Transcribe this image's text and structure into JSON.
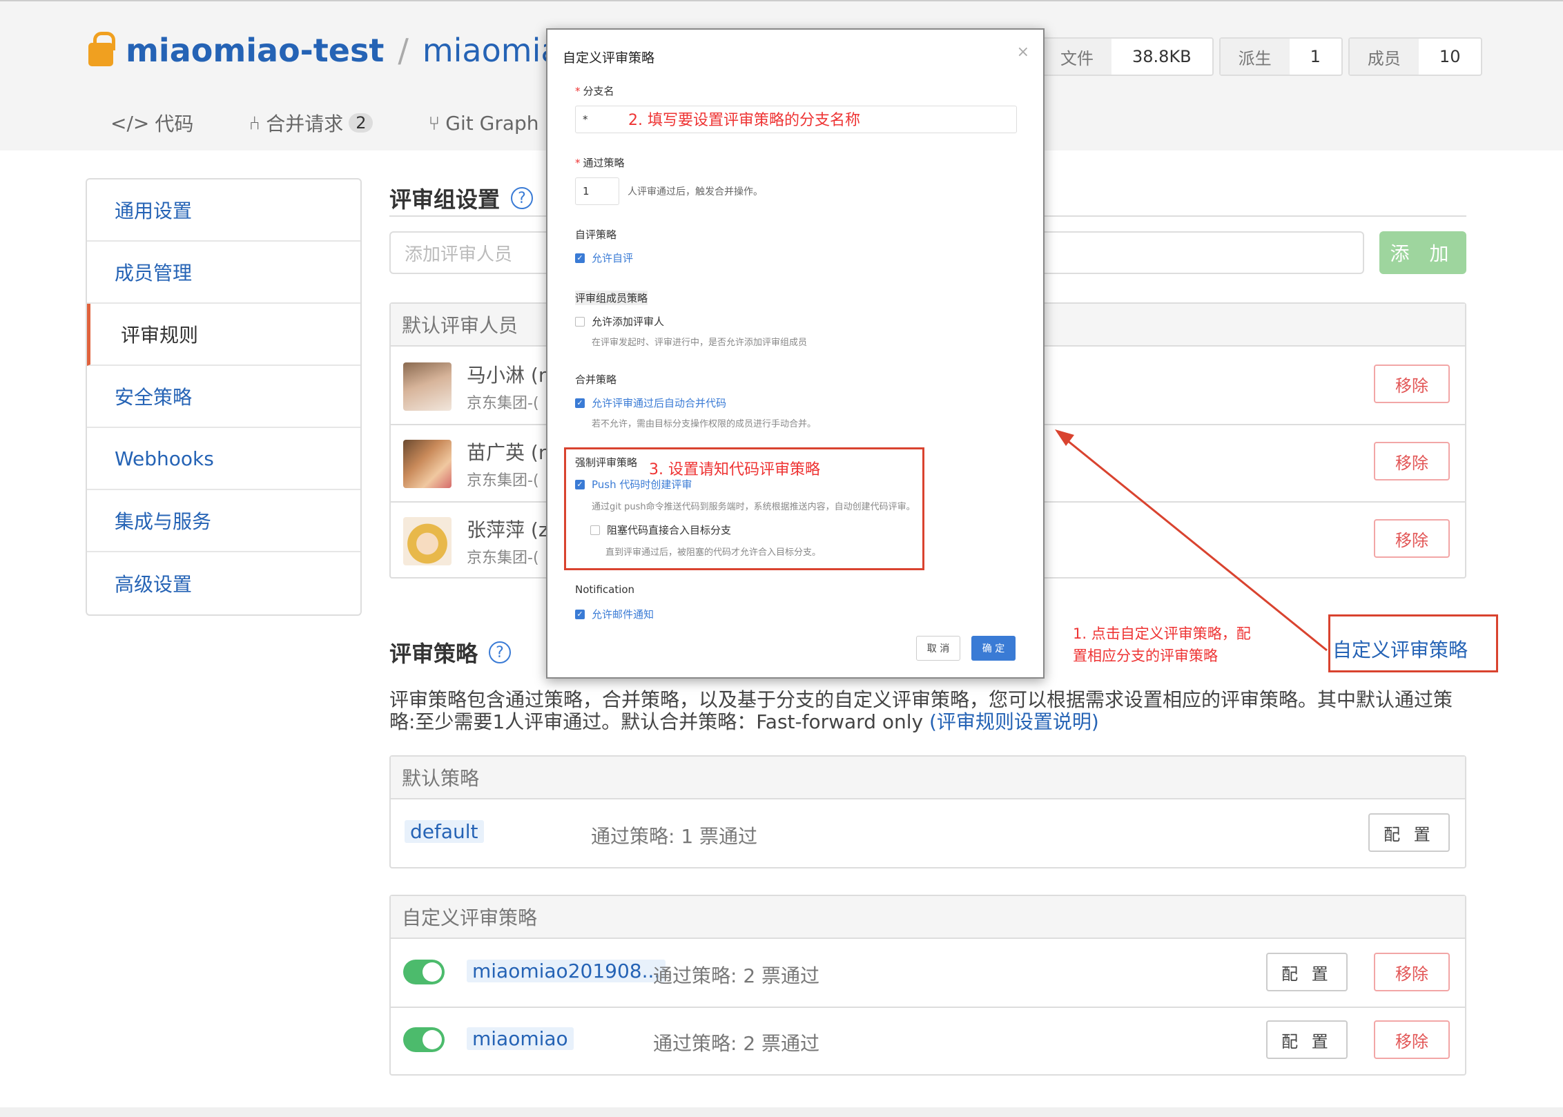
{
  "header": {
    "owner": "miaomiao-test",
    "separator": "/",
    "repo": "miaomiao2(",
    "nav": [
      {
        "icon": "</>",
        "label": "代码"
      },
      {
        "icon": "⑃",
        "label": "合并请求",
        "badge": "2"
      },
      {
        "icon": "⑂",
        "label": "Git Graph"
      }
    ],
    "stats": [
      {
        "key": "文件",
        "value": "38.8KB"
      },
      {
        "key": "派生",
        "value": "1"
      },
      {
        "key": "成员",
        "value": "10"
      }
    ]
  },
  "sidebar": {
    "items": [
      {
        "label": "通用设置"
      },
      {
        "label": "成员管理"
      },
      {
        "label": "评审规则",
        "active": true
      },
      {
        "label": "安全策略"
      },
      {
        "label": "Webhooks"
      },
      {
        "label": "集成与服务"
      },
      {
        "label": "高级设置"
      }
    ]
  },
  "review_group": {
    "title": "评审组设置",
    "help": "?",
    "add_placeholder": "添加评审人员",
    "add_button": "添 加",
    "default_header": "默认评审人员",
    "reviewers": [
      {
        "name": "马小淋 (n",
        "org": "京东集团-(",
        "remove": "移除"
      },
      {
        "name": "苗广英 (n",
        "org": "京东集团-(",
        "remove": "移除"
      },
      {
        "name": "张萍萍 (z",
        "org": "京东集团-(",
        "remove": "移除"
      }
    ]
  },
  "strategy": {
    "title": "评审策略",
    "help": "?",
    "desc_line1": "评审策略包含通过策略，合并策略，以及基于分支的自定义评审策略，您可以根据需求设置相应的评审策略。其中默认通过策",
    "desc_line2": "略:至少需要1人评审通过。默认合并策略：Fast-forward only ",
    "desc_link": "(评审规则设置说明)",
    "default_header": "默认策略",
    "default_branch": "default",
    "default_policy": "通过策略: 1 票通过",
    "config": "配 置",
    "custom_header": "自定义评审策略",
    "custom": [
      {
        "branch": "miaomiao201908...",
        "policy": "通过策略: 2 票通过",
        "config": "配 置",
        "remove": "移除"
      },
      {
        "branch": "miaomiao",
        "policy": "通过策略: 2 票通过",
        "config": "配 置",
        "remove": "移除"
      }
    ]
  },
  "modal": {
    "title": "自定义评审策略",
    "close": "×",
    "branch_label": "分支名",
    "branch_value": "*",
    "pass_label": "通过策略",
    "pass_value": "1",
    "pass_suffix": "人评审通过后，触发合并操作。",
    "self_label": "自评策略",
    "self_cb": "允许自评",
    "group_label": "评审组成员策略",
    "group_cb": "允许添加评审人",
    "group_hint": "在评审发起时、评审进行中，是否允许添加评审组成员",
    "merge_label": "合并策略",
    "merge_cb": "允许评审通过后自动合并代码",
    "merge_hint": "若不允许，需由目标分支操作权限的成员进行手动合并。",
    "force_label": "强制评审策略",
    "push_cb": "Push 代码时创建评审",
    "push_hint": "通过git push命令推送代码到服务端时，系统根据推送内容，自动创建代码评审。",
    "block_cb": "阻塞代码直接合入目标分支",
    "block_hint": "直到评审通过后，被阻塞的代码才允许合入目标分支。",
    "notify_label": "Notification",
    "notify_cb": "允许邮件通知",
    "cancel": "取 消",
    "ok": "确 定"
  },
  "annotations": {
    "step1": "1. 点击自定义评审策略，配",
    "step1b": "置相应分支的评审策略",
    "step2": "2. 填写要设置评审策略的分支名称",
    "step3": "3. 设置请知代码评审策略",
    "target": "自定义评审策略"
  },
  "colors": {
    "accent": "#2563b5",
    "danger": "#e25555",
    "success": "#4cbb6c",
    "annotation": "#d9432f"
  }
}
